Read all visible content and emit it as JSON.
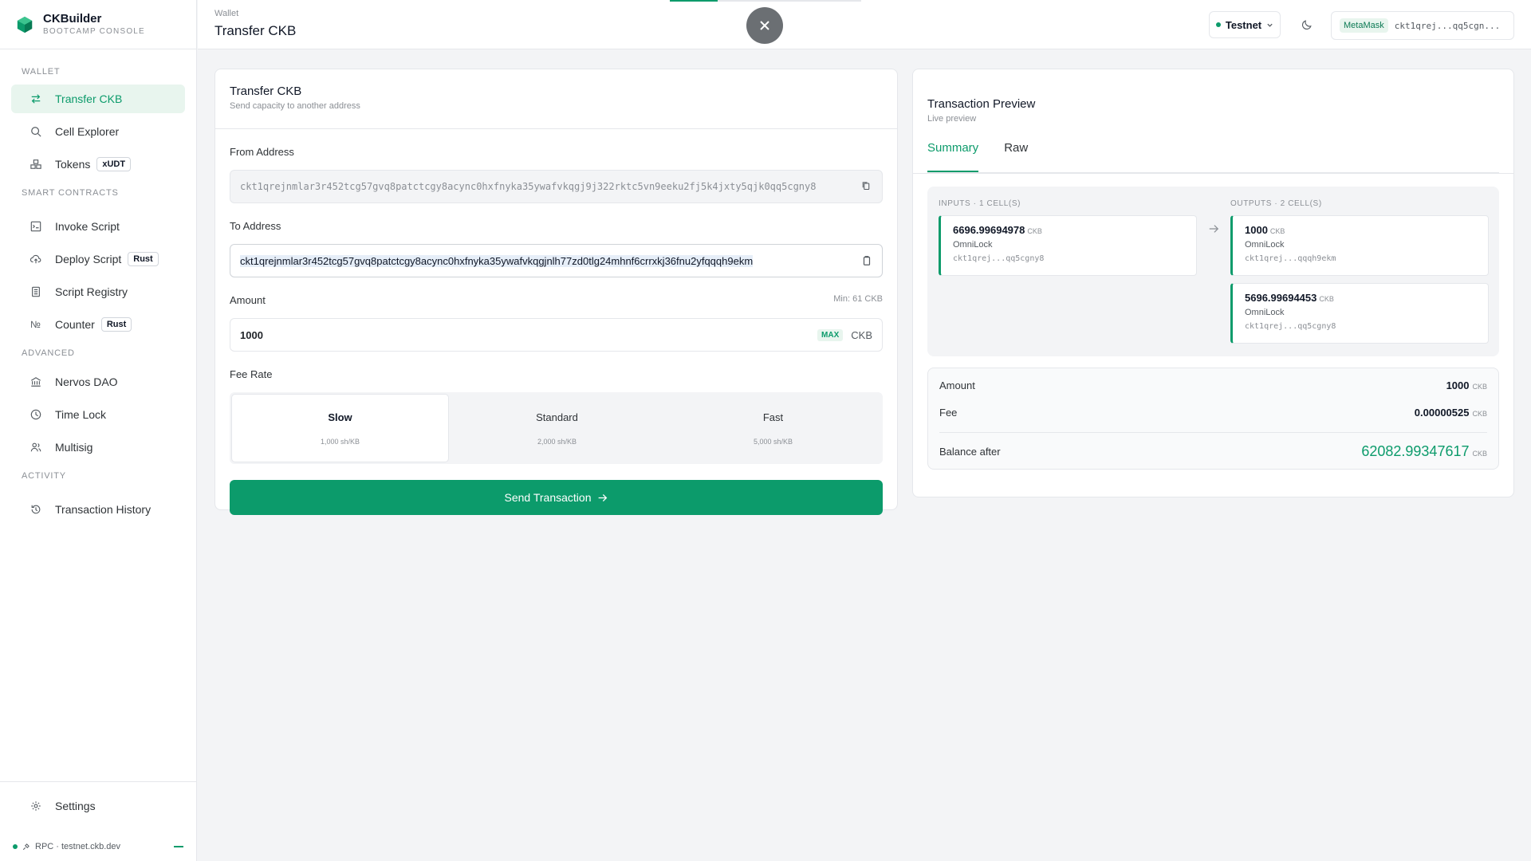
{
  "brand": {
    "name": "CKBuilder",
    "subtitle": "BOOTCAMP CONSOLE"
  },
  "sidebar": {
    "sections": [
      {
        "label": "WALLET",
        "items": [
          {
            "label": "Transfer CKB",
            "icon": "transfer-icon",
            "active": true
          },
          {
            "label": "Cell Explorer",
            "icon": "search-icon"
          },
          {
            "label": "Tokens",
            "icon": "tokens-icon",
            "tag": "xUDT"
          }
        ]
      },
      {
        "label": "SMART CONTRACTS",
        "items": [
          {
            "label": "Invoke Script",
            "icon": "terminal-icon"
          },
          {
            "label": "Deploy Script",
            "icon": "cloud-upload-icon",
            "tag": "Rust"
          },
          {
            "label": "Script Registry",
            "icon": "book-icon"
          },
          {
            "label": "Counter",
            "icon": "number-icon",
            "tag": "Rust"
          }
        ]
      },
      {
        "label": "ADVANCED",
        "items": [
          {
            "label": "Nervos DAO",
            "icon": "bank-icon"
          },
          {
            "label": "Time Lock",
            "icon": "clock-icon"
          },
          {
            "label": "Multisig",
            "icon": "users-icon"
          }
        ]
      },
      {
        "label": "ACTIVITY",
        "items": [
          {
            "label": "Transaction History",
            "icon": "history-icon"
          }
        ]
      }
    ],
    "settings_label": "Settings",
    "rpc_label": "RPC · testnet.ckb.dev"
  },
  "header": {
    "breadcrumb": "Wallet",
    "title": "Transfer CKB",
    "progress": 0.25,
    "network": "Testnet",
    "wallet_badge": "MetaMask",
    "wallet_address": "ckt1qrej...qq5cgn..."
  },
  "transfer": {
    "title": "Transfer CKB",
    "subtitle": "Send capacity to another address",
    "from_label": "From Address",
    "from_value": "ckt1qrejnmlar3r452tcg57gvq8patctcgy8acync0hxfnyka35ywafvkqgj9j322rktc5vn9eeku2fj5k4jxty5qjk0qq5cgny8",
    "to_label": "To Address",
    "to_value": "ckt1qrejnmlar3r452tcg57gvq8patctcgy8acync0hxfnyka35ywafvkqgjnlh77zd0tlg24mhnf6crrxkj36fnu2yfqqqh9ekm",
    "amount_label": "Amount",
    "amount_hint": "Min: 61 CKB",
    "amount_value": "1000",
    "max_label": "MAX",
    "unit": "CKB",
    "fee_label": "Fee Rate",
    "fees": [
      {
        "name": "Slow",
        "rate": "1,000 sh/KB"
      },
      {
        "name": "Standard",
        "rate": "2,000 sh/KB"
      },
      {
        "name": "Fast",
        "rate": "5,000 sh/KB"
      }
    ],
    "send_label": "Send Transaction"
  },
  "preview": {
    "title": "Transaction Preview",
    "subtitle": "Live preview",
    "tabs": [
      "Summary",
      "Raw"
    ],
    "inputs_label": "INPUTS · 1 CELL(S)",
    "outputs_label": "OUTPUTS · 2 CELL(S)",
    "inputs": [
      {
        "amount": "6696.99694978",
        "unit": "CKB",
        "lock": "OmniLock",
        "address": "ckt1qrej...qq5cgny8"
      }
    ],
    "outputs": [
      {
        "amount": "1000",
        "unit": "CKB",
        "lock": "OmniLock",
        "address": "ckt1qrej...qqqh9ekm"
      },
      {
        "amount": "5696.99694453",
        "unit": "CKB",
        "lock": "OmniLock",
        "address": "ckt1qrej...qq5cgny8"
      }
    ],
    "summary": {
      "amount_label": "Amount",
      "amount_value": "1000",
      "fee_label": "Fee",
      "fee_value": "0.00000525",
      "balance_label": "Balance after",
      "balance_value": "62082.99347617",
      "unit": "CKB"
    }
  },
  "colors": {
    "accent": "#0c9b6b",
    "accent_light": "#e8f5ee"
  }
}
